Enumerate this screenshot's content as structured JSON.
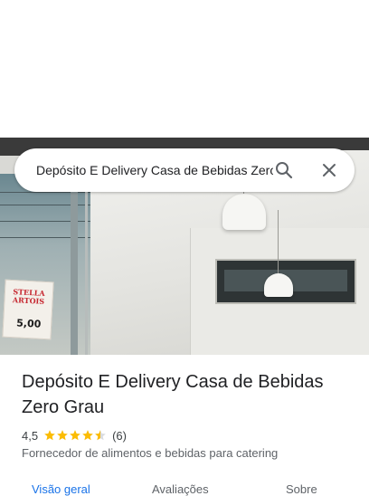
{
  "search": {
    "query": "Depósito E Delivery Casa de Bebidas Zero Grau"
  },
  "place": {
    "name": "Depósito E Delivery Casa de Bebidas Zero Grau",
    "rating": "4,5",
    "rating_value": 4.5,
    "review_count": "(6)",
    "category": "Fornecedor de alimentos e bebidas para catering"
  },
  "photo_sign": {
    "brand": "STELLA ARTOIS",
    "price": "5,00"
  },
  "tabs": [
    {
      "label": "Visão geral",
      "active": true
    },
    {
      "label": "Avaliações",
      "active": false
    },
    {
      "label": "Sobre",
      "active": false
    }
  ],
  "colors": {
    "accent": "#1a73e8",
    "star": "#fbbc04",
    "text": "#202124",
    "secondary": "#5f6368"
  },
  "icons": {
    "search": "search-icon",
    "close": "close-icon",
    "star": "star-icon"
  }
}
